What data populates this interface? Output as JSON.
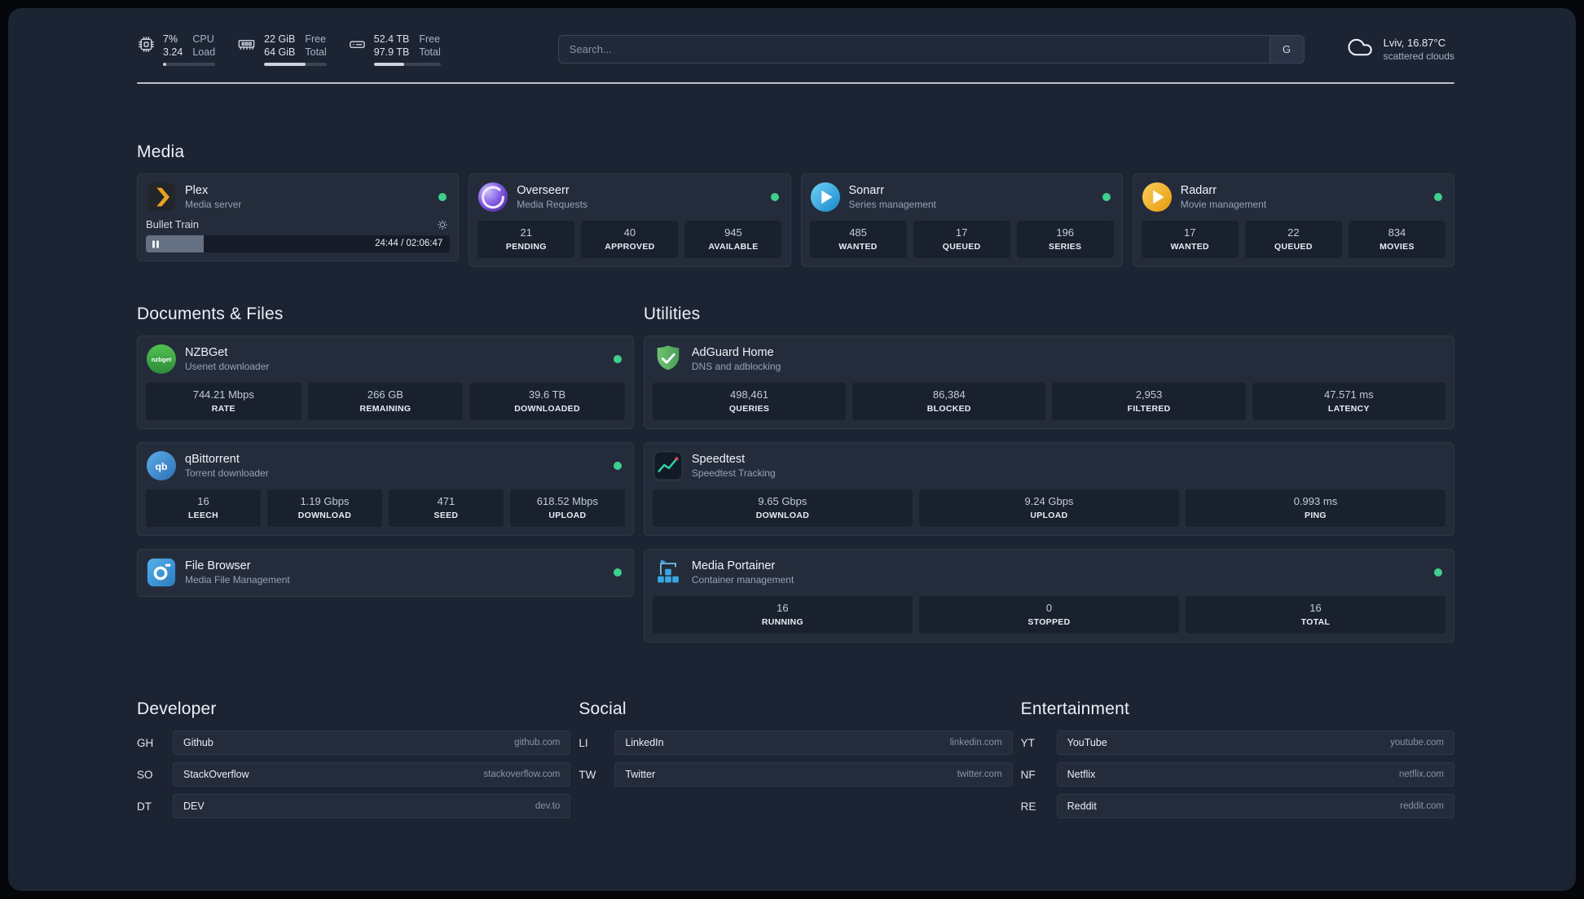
{
  "header": {
    "widgets": [
      {
        "name": "cpu",
        "values": [
          "7%",
          "3.24"
        ],
        "labels": [
          "CPU",
          "Load"
        ],
        "bar_pct": 7
      },
      {
        "name": "memory",
        "values": [
          "22 GiB",
          "64 GiB"
        ],
        "labels": [
          "Free",
          "Total"
        ],
        "bar_pct": 66
      },
      {
        "name": "disk",
        "values": [
          "52.4 TB",
          "97.9 TB"
        ],
        "labels": [
          "Free",
          "Total"
        ],
        "bar_pct": 46
      }
    ],
    "search": {
      "placeholder": "Search...",
      "button_label": "G"
    },
    "weather": {
      "location": "Lviv, 16.87°C",
      "condition": "scattered clouds"
    }
  },
  "sections": {
    "media": {
      "title": "Media",
      "cards": [
        {
          "name": "Plex",
          "desc": "Media server",
          "player": {
            "title": "Bullet Train",
            "time": "24:44 / 02:06:47",
            "progress_pct": 19
          }
        },
        {
          "name": "Overseerr",
          "desc": "Media Requests",
          "stats": [
            {
              "value": "21",
              "label": "PENDING"
            },
            {
              "value": "40",
              "label": "APPROVED"
            },
            {
              "value": "945",
              "label": "AVAILABLE"
            }
          ]
        },
        {
          "name": "Sonarr",
          "desc": "Series management",
          "stats": [
            {
              "value": "485",
              "label": "WANTED"
            },
            {
              "value": "17",
              "label": "QUEUED"
            },
            {
              "value": "196",
              "label": "SERIES"
            }
          ]
        },
        {
          "name": "Radarr",
          "desc": "Movie management",
          "stats": [
            {
              "value": "17",
              "label": "WANTED"
            },
            {
              "value": "22",
              "label": "QUEUED"
            },
            {
              "value": "834",
              "label": "MOVIES"
            }
          ]
        }
      ]
    },
    "documents": {
      "title": "Documents & Files",
      "cards": [
        {
          "name": "NZBGet",
          "desc": "Usenet downloader",
          "stats": [
            {
              "value": "744.21 Mbps",
              "label": "RATE"
            },
            {
              "value": "266 GB",
              "label": "REMAINING"
            },
            {
              "value": "39.6 TB",
              "label": "DOWNLOADED"
            }
          ]
        },
        {
          "name": "qBittorrent",
          "desc": "Torrent downloader",
          "stats": [
            {
              "value": "16",
              "label": "LEECH"
            },
            {
              "value": "1.19 Gbps",
              "label": "DOWNLOAD"
            },
            {
              "value": "471",
              "label": "SEED"
            },
            {
              "value": "618.52 Mbps",
              "label": "UPLOAD"
            }
          ]
        },
        {
          "name": "File Browser",
          "desc": "Media File Management"
        }
      ]
    },
    "utilities": {
      "title": "Utilities",
      "cards": [
        {
          "name": "AdGuard Home",
          "desc": "DNS and adblocking",
          "stats": [
            {
              "value": "498,461",
              "label": "QUERIES"
            },
            {
              "value": "86,384",
              "label": "BLOCKED"
            },
            {
              "value": "2,953",
              "label": "FILTERED"
            },
            {
              "value": "47.571 ms",
              "label": "LATENCY"
            }
          ]
        },
        {
          "name": "Speedtest",
          "desc": "Speedtest Tracking",
          "stats": [
            {
              "value": "9.65 Gbps",
              "label": "DOWNLOAD"
            },
            {
              "value": "9.24 Gbps",
              "label": "UPLOAD"
            },
            {
              "value": "0.993 ms",
              "label": "PING"
            }
          ]
        },
        {
          "name": "Media Portainer",
          "desc": "Container management",
          "stats": [
            {
              "value": "16",
              "label": "RUNNING"
            },
            {
              "value": "0",
              "label": "STOPPED"
            },
            {
              "value": "16",
              "label": "TOTAL"
            }
          ]
        }
      ]
    }
  },
  "bookmarks": [
    {
      "title": "Developer",
      "items": [
        {
          "abbr": "GH",
          "name": "Github",
          "url": "github.com"
        },
        {
          "abbr": "SO",
          "name": "StackOverflow",
          "url": "stackoverflow.com"
        },
        {
          "abbr": "DT",
          "name": "DEV",
          "url": "dev.to"
        }
      ]
    },
    {
      "title": "Social",
      "items": [
        {
          "abbr": "LI",
          "name": "LinkedIn",
          "url": "linkedin.com"
        },
        {
          "abbr": "TW",
          "name": "Twitter",
          "url": "twitter.com"
        }
      ]
    },
    {
      "title": "Entertainment",
      "items": [
        {
          "abbr": "YT",
          "name": "YouTube",
          "url": "youtube.com"
        },
        {
          "abbr": "NF",
          "name": "Netflix",
          "url": "netflix.com"
        },
        {
          "abbr": "RE",
          "name": "Reddit",
          "url": "reddit.com"
        }
      ]
    }
  ],
  "colors": {
    "panel_bg": "#1c2433",
    "card_bg": "#242c3b",
    "status_online": "#3ecf8e",
    "accent_line": "#2ed3a2"
  }
}
